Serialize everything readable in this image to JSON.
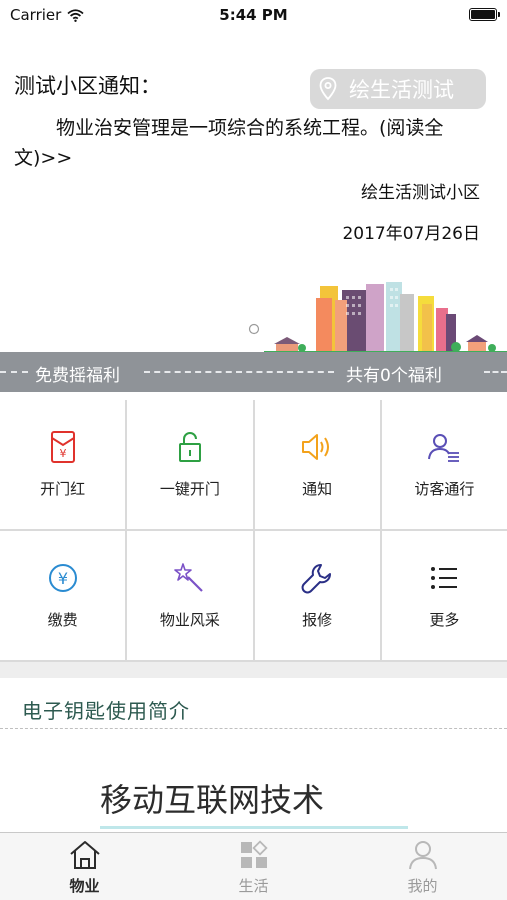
{
  "status_bar": {
    "carrier": "Carrier",
    "time": "5:44 PM",
    "battery_level": 1.0
  },
  "notice": {
    "title": "测试小区通知：",
    "body": "物业治安管理是一项综合的系统工程。(阅读全文)>>",
    "sign": "绘生活测试小区",
    "date": "2017年07月26日"
  },
  "location": {
    "label": "绘生活测试",
    "icon": "location-pin-icon"
  },
  "welfare": {
    "left_text": "免费摇福利",
    "right_text": "共有0个福利"
  },
  "services": [
    {
      "label": "开门红",
      "icon": "red-envelope-icon",
      "color": "#e0322c"
    },
    {
      "label": "一键开门",
      "icon": "unlock-icon",
      "color": "#2ea043"
    },
    {
      "label": "通知",
      "icon": "speaker-icon",
      "color": "#f3a21b"
    },
    {
      "label": "访客通行",
      "icon": "visitor-icon",
      "color": "#5a4fb6"
    },
    {
      "label": "缴费",
      "icon": "yuan-coin-icon",
      "color": "#2a8bd1"
    },
    {
      "label": "物业风采",
      "icon": "magic-wand-icon",
      "color": "#7b52c7"
    },
    {
      "label": "报修",
      "icon": "wrench-icon",
      "color": "#2a2f86"
    },
    {
      "label": "更多",
      "icon": "list-icon",
      "color": "#222222"
    }
  ],
  "intro": {
    "title": "电子钥匙使用简介",
    "banner_text": "移动互联网技术"
  },
  "tabs": [
    {
      "label": "物业",
      "icon": "home-icon",
      "active": true
    },
    {
      "label": "生活",
      "icon": "apps-icon",
      "active": false
    },
    {
      "label": "我的",
      "icon": "user-icon",
      "active": false
    }
  ]
}
